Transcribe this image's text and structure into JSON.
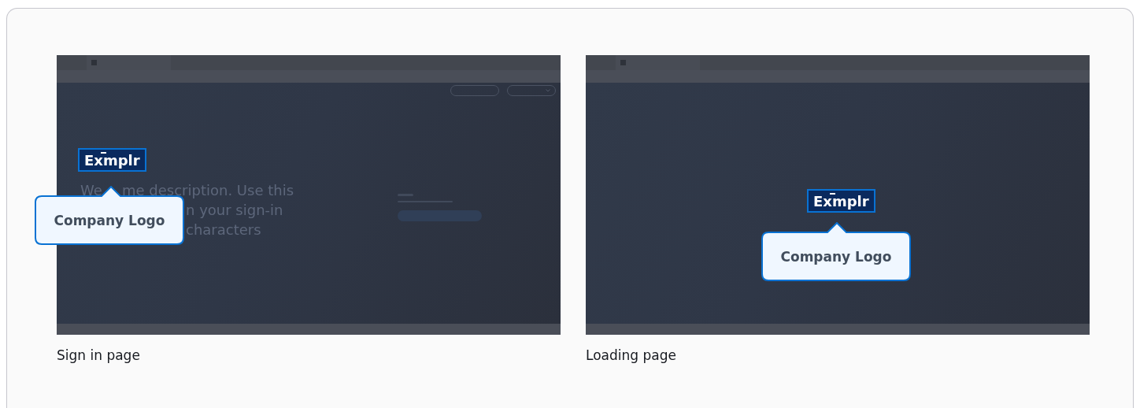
{
  "figures": [
    {
      "kind": "sign_in",
      "logo": "Exmplr",
      "description_fragments": [
        "We",
        "me description. Use this",
        "n your sign-in",
        "characters"
      ],
      "callout": "Company Logo",
      "caption": "Sign in page"
    },
    {
      "kind": "loading",
      "logo": "Exmplr",
      "callout": "Company Logo",
      "caption": "Loading page"
    }
  ]
}
